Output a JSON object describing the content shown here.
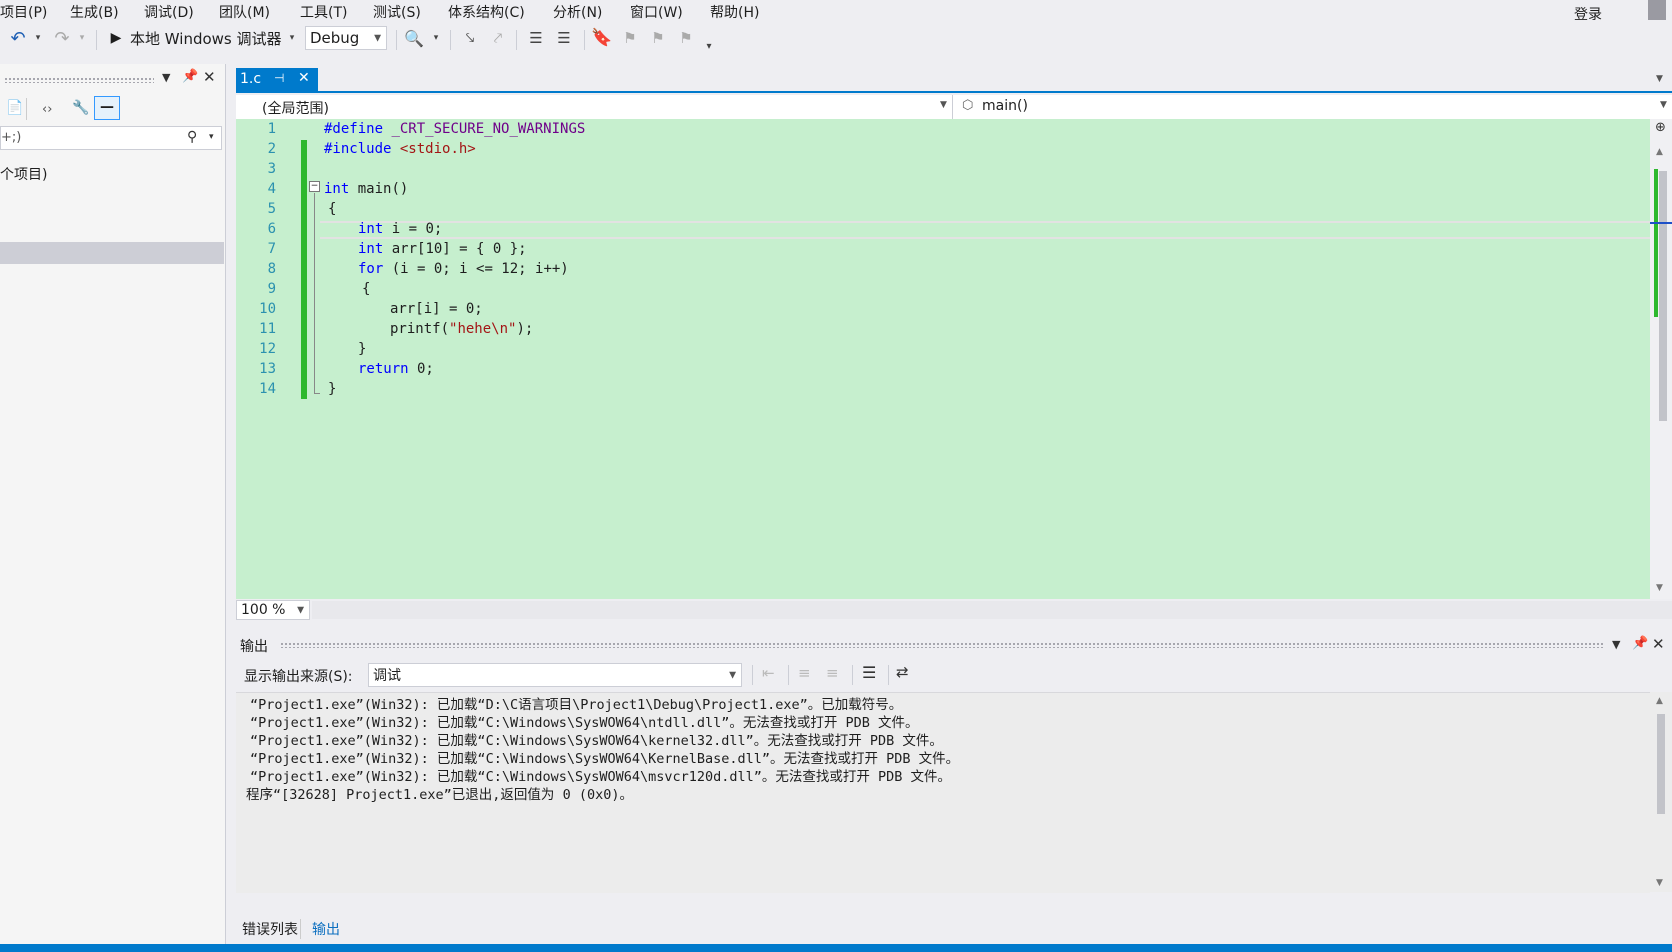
{
  "menu": [
    "项目(P)",
    "生成(B)",
    "调试(D)",
    "团队(M)",
    "工具(T)",
    "测试(S)",
    "体系结构(C)",
    "分析(N)",
    "窗口(W)",
    "帮助(H)"
  ],
  "login": "登录",
  "toolbar": {
    "debugger_label": "本地 Windows 调试器",
    "config": "Debug"
  },
  "left_panel": {
    "search_placeholder": "+;)",
    "item_label": "个项目)"
  },
  "editor": {
    "tab_title": "1.c",
    "scope": "(全局范围)",
    "member": "main()",
    "zoom": "100 %",
    "line_numbers": [
      "1",
      "2",
      "3",
      "4",
      "5",
      "6",
      "7",
      "8",
      "9",
      "10",
      "11",
      "12",
      "13",
      "14"
    ],
    "code": {
      "l1_kw": "#define",
      "l1_rest": " _CRT_SECURE_NO_WARNINGS",
      "l2_kw": "#include",
      "l2_sp": " ",
      "l2_str": "<stdio.h>",
      "l4_kw": "int",
      "l4_rest": " main()",
      "l5": "{",
      "l6_kw": "int",
      "l6_rest": " i = 0;",
      "l7_kw": "int",
      "l7_rest": " arr[10] = { 0 };",
      "l8_kw": "for",
      "l8_rest": " (i = 0; i <= 12; i++)",
      "l9": "{",
      "l10": "arr[i] = 0;",
      "l11_a": "printf(",
      "l11_str": "\"hehe\\n\"",
      "l11_b": ");",
      "l12": "}",
      "l13_kw": "return",
      "l13_rest": " 0;",
      "l14": "}"
    }
  },
  "output": {
    "title": "输出",
    "source_label": "显示输出来源(S):",
    "source_value": "调试",
    "lines": [
      "“Project1.exe”(Win32): 已加载“D:\\C语言项目\\Project1\\Debug\\Project1.exe”。已加载符号。",
      "“Project1.exe”(Win32): 已加载“C:\\Windows\\SysWOW64\\ntdll.dll”。无法查找或打开 PDB 文件。",
      "“Project1.exe”(Win32): 已加载“C:\\Windows\\SysWOW64\\kernel32.dll”。无法查找或打开 PDB 文件。",
      "“Project1.exe”(Win32): 已加载“C:\\Windows\\SysWOW64\\KernelBase.dll”。无法查找或打开 PDB 文件。",
      "“Project1.exe”(Win32): 已加载“C:\\Windows\\SysWOW64\\msvcr120d.dll”。无法查找或打开 PDB 文件。",
      "程序“[32628] Project1.exe”已退出,返回值为 0 (0x0)。"
    ]
  },
  "bottom_tabs": [
    "错误列表",
    "输出"
  ],
  "colors": {
    "accent": "#007acc",
    "editor_bg": "#c6efce",
    "changebar": "#2eb82e",
    "keyword": "#0000ff",
    "string": "#a31515"
  }
}
